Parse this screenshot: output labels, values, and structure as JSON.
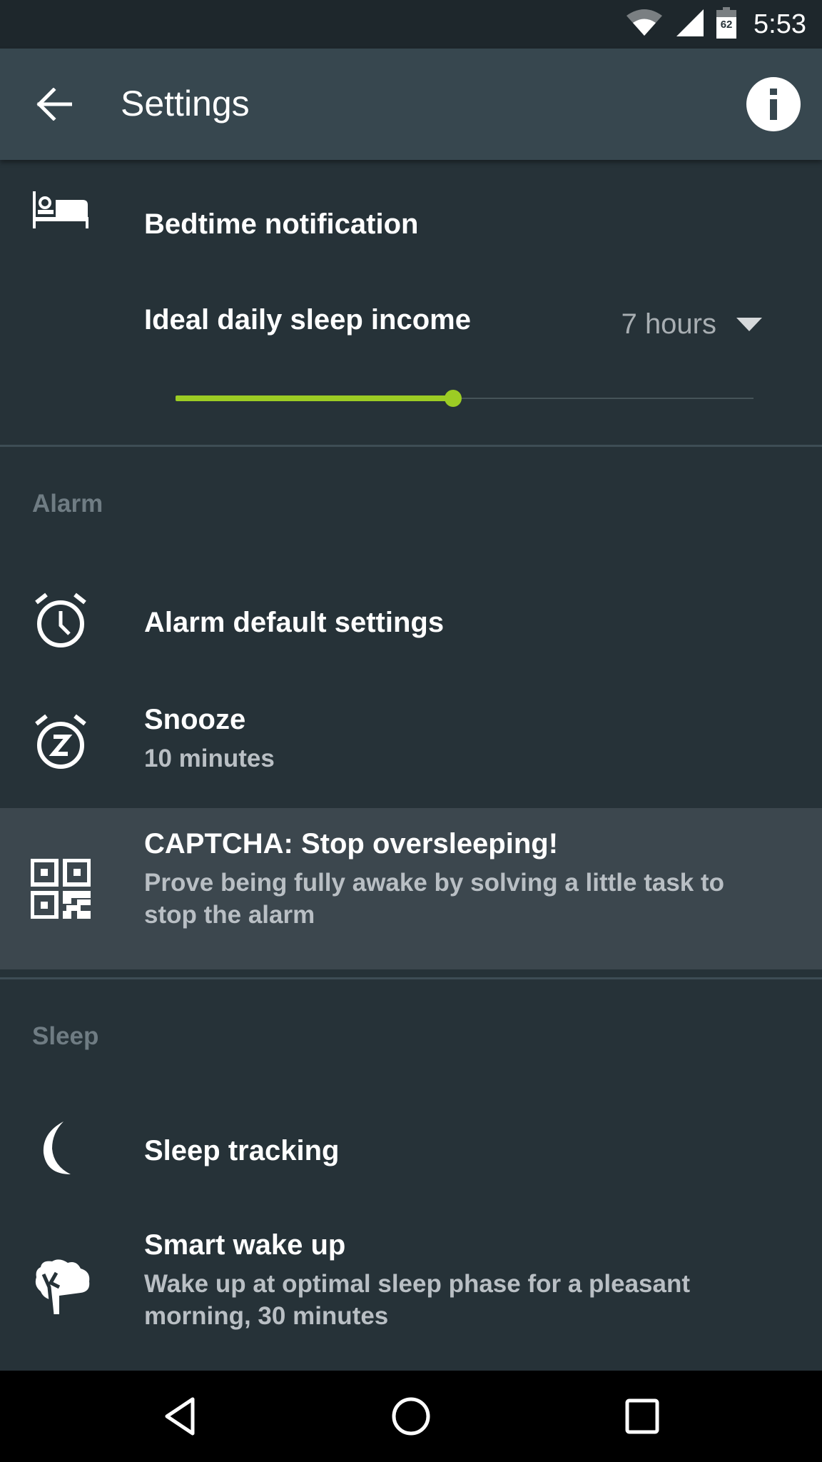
{
  "status_bar": {
    "time": "5:53",
    "battery_level": "62",
    "icons": [
      "wifi-icon",
      "cell-signal-icon",
      "battery-icon"
    ]
  },
  "app_bar": {
    "title": "Settings",
    "back_icon": "arrow-left-icon",
    "info_icon": "info-icon"
  },
  "bedtime": {
    "icon": "bed-icon",
    "title": "Bedtime notification",
    "sleep_income_label": "Ideal daily sleep income",
    "sleep_income_value": "7 hours",
    "slider_fraction": 0.48,
    "accent_color": "#9ccc24"
  },
  "sections": {
    "alarm": {
      "header": "Alarm",
      "items": [
        {
          "icon": "alarm-clock-icon",
          "title": "Alarm default settings"
        },
        {
          "icon": "snooze-icon",
          "title": "Snooze",
          "subtitle": "10 minutes"
        },
        {
          "icon": "qr-code-icon",
          "title": "CAPTCHA: Stop oversleeping!",
          "subtitle": "Prove being fully awake by solving a little task to stop the alarm",
          "highlighted": true
        }
      ]
    },
    "sleep": {
      "header": "Sleep",
      "items": [
        {
          "icon": "moon-icon",
          "title": "Sleep tracking"
        },
        {
          "icon": "tree-icon",
          "title": "Smart wake up",
          "subtitle": "Wake up at optimal sleep phase for a pleasant morning, 30 minutes"
        }
      ]
    }
  },
  "nav_bar": {
    "buttons": [
      "nav-back-icon",
      "nav-home-icon",
      "nav-recents-icon"
    ]
  }
}
